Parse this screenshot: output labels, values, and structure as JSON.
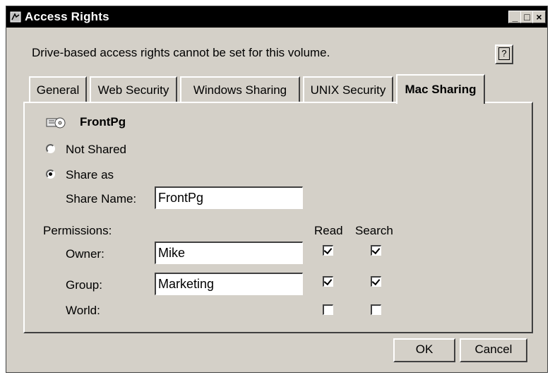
{
  "window": {
    "title": "Access Rights",
    "min_label": "_",
    "max_label": "□",
    "close_label": "×"
  },
  "message": "Drive-based access rights cannot be set for this volume.",
  "help_label": "?",
  "tabs": [
    {
      "label": "General",
      "active": false
    },
    {
      "label": "Web Security",
      "active": false
    },
    {
      "label": "Windows Sharing",
      "active": false
    },
    {
      "label": "UNIX Security",
      "active": false
    },
    {
      "label": "Mac Sharing",
      "active": true
    }
  ],
  "volume": {
    "icon": "drive-icon",
    "name": "FrontPg"
  },
  "sharing": {
    "not_shared_label": "Not Shared",
    "share_as_label": "Share as",
    "selected": "share_as",
    "share_name_label": "Share Name:",
    "share_name_value": "FrontPg"
  },
  "permissions": {
    "label": "Permissions:",
    "read_header": "Read",
    "search_header": "Search",
    "rows": [
      {
        "label": "Owner:",
        "value": "Mike",
        "read": true,
        "search": true
      },
      {
        "label": "Group:",
        "value": "Marketing",
        "read": true,
        "search": true
      },
      {
        "label": "World:",
        "value": null,
        "read": false,
        "search": false
      }
    ]
  },
  "buttons": {
    "ok": "OK",
    "cancel": "Cancel"
  }
}
